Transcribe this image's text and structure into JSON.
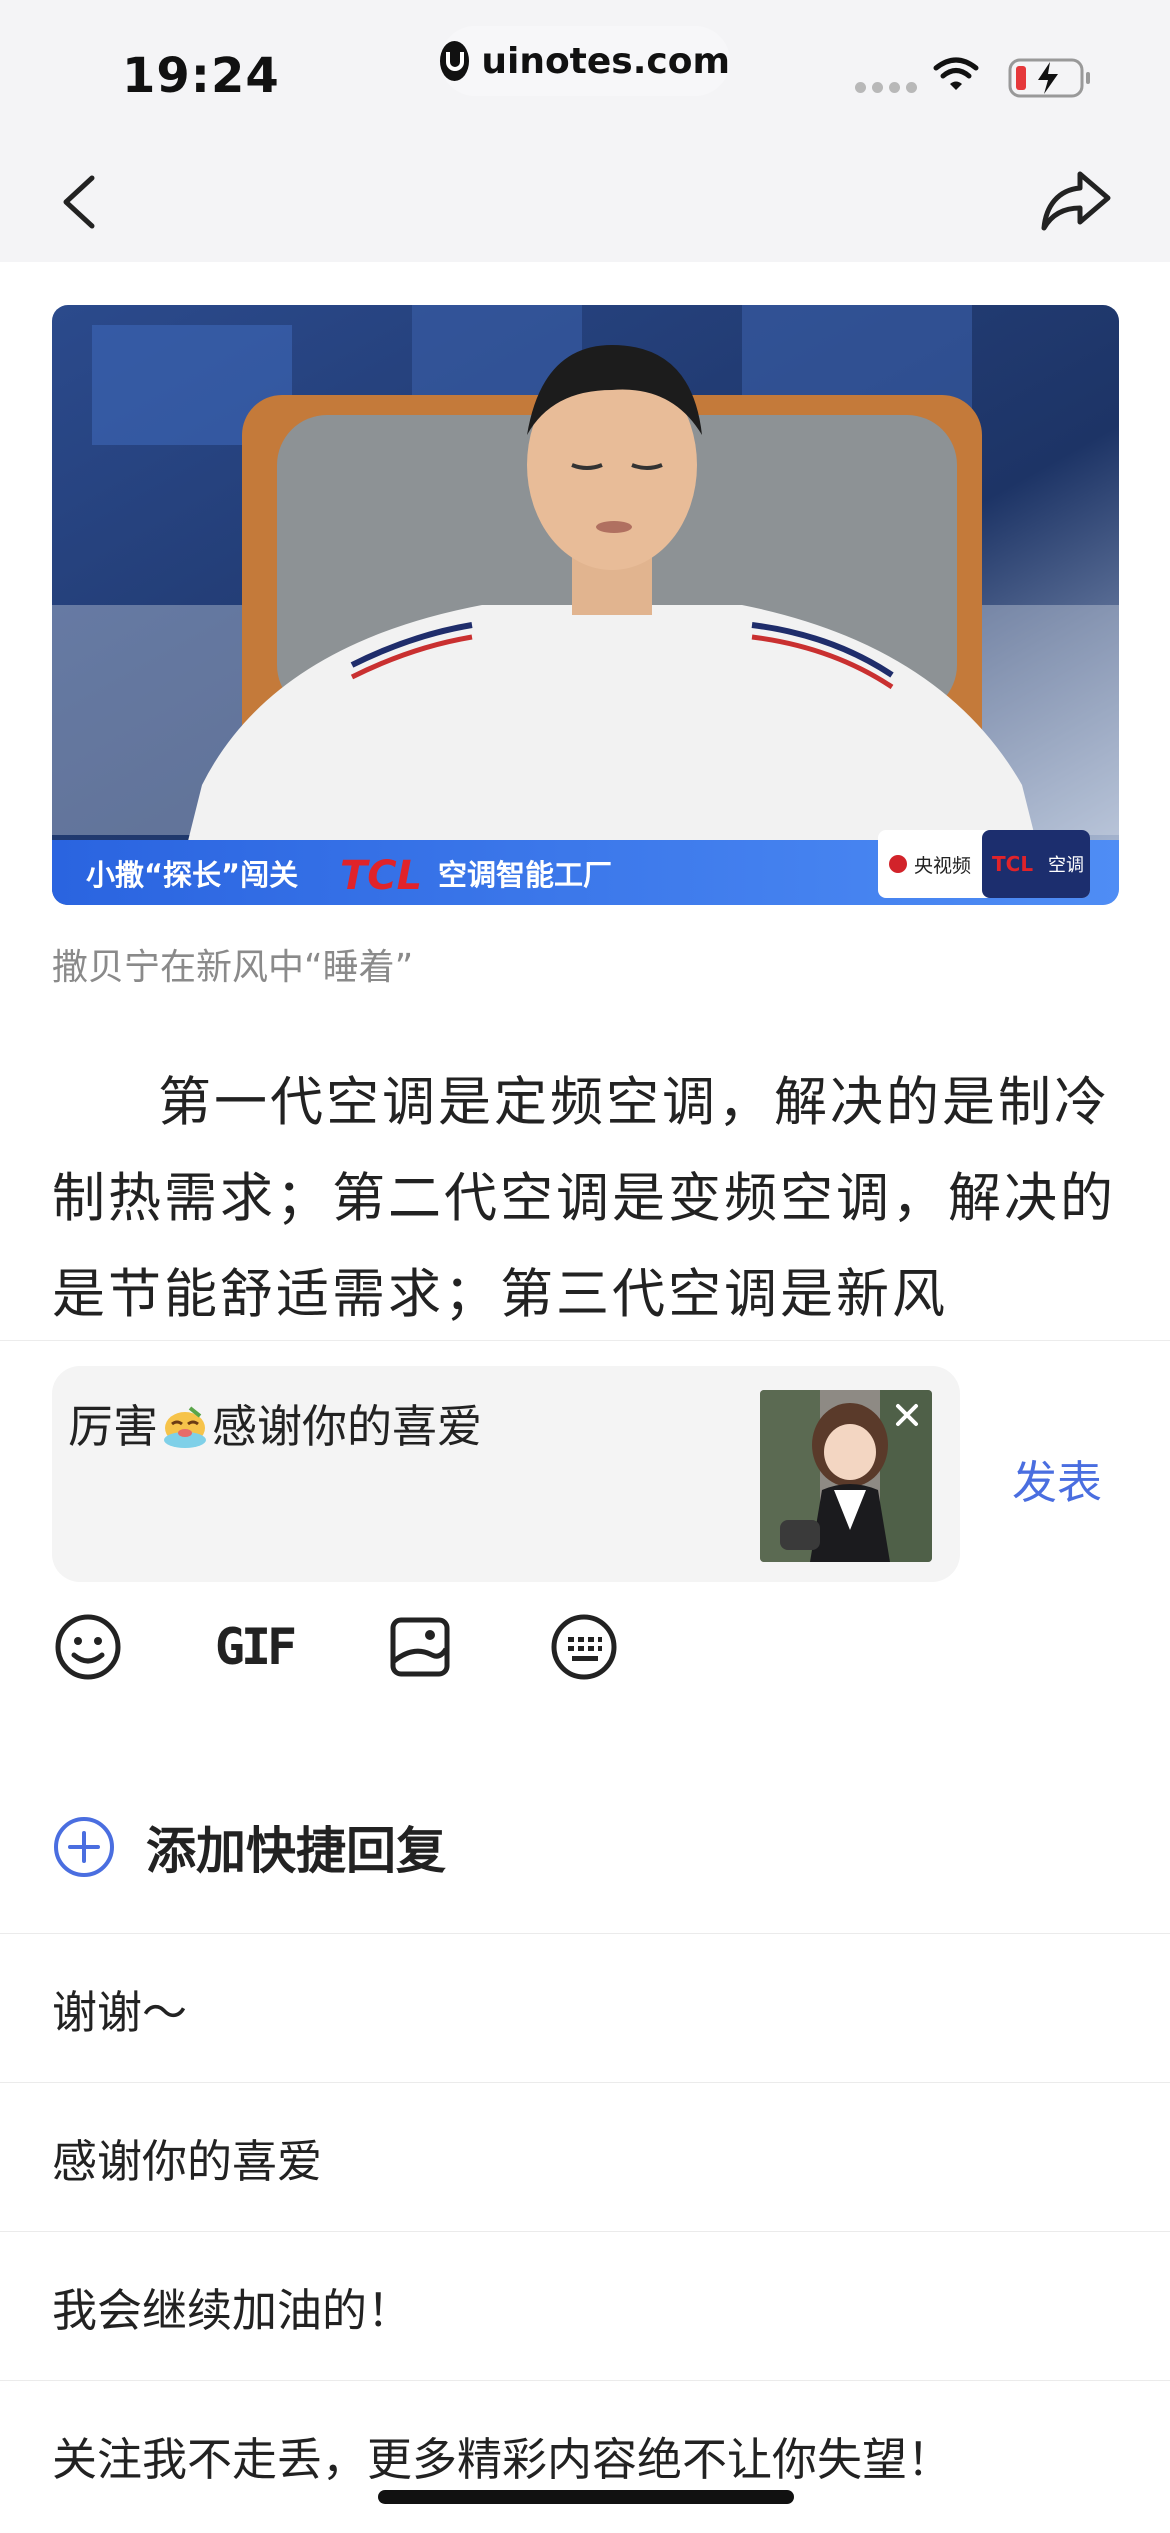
{
  "status_bar": {
    "time": "19:24",
    "url": "uinotes.com"
  },
  "article": {
    "image_overlay": {
      "banner_text_1": "小撒“探长”闯关",
      "banner_brand": "TCL",
      "banner_text_2": "空调智能工厂",
      "badge_left": "央视频",
      "badge_brand": "TCL",
      "badge_text": "空调"
    },
    "caption": "撒贝宁在新风中“睡着”",
    "body": "第一代空调是定频空调，解决的是制冷制热需求；第二代空调是变频空调，解决的是节能舒适需求；第三代空调是新风"
  },
  "reply": {
    "input_text_before": "厉害",
    "input_text_after": "感谢你的喜爱",
    "publish_label": "发表",
    "toolbar": {
      "gif_label": "GIF"
    },
    "add_quick_label": "添加快捷回复",
    "quick_replies": [
      "谢谢～",
      "感谢你的喜爱",
      "我会继续加油的！",
      "关注我不走丢，更多精彩内容绝不让你失望！"
    ]
  },
  "colors": {
    "accent": "#4a6ee0",
    "background": "#ffffff",
    "status_bg": "#f4f4f6"
  }
}
